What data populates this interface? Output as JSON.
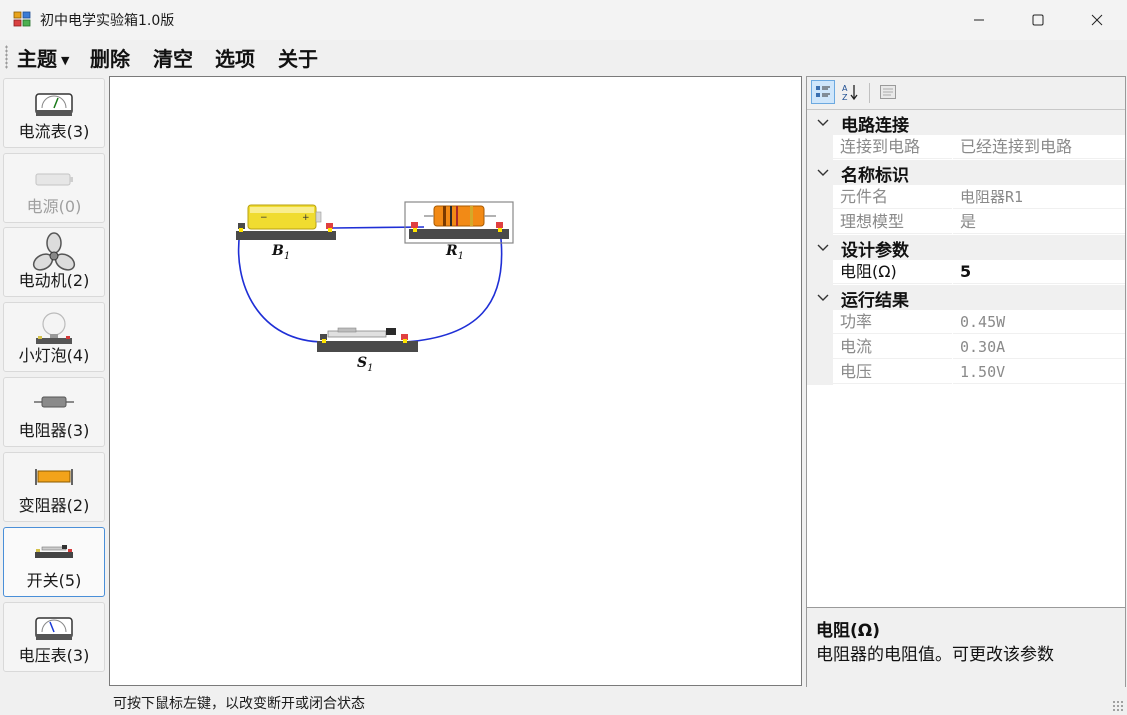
{
  "window": {
    "title": "初中电学实验箱1.0版",
    "buttons": [
      "minimize",
      "maximize",
      "close"
    ]
  },
  "menu": {
    "items": [
      {
        "label": "主题",
        "has_dropdown": true
      },
      {
        "label": "删除"
      },
      {
        "label": "清空"
      },
      {
        "label": "选项"
      },
      {
        "label": "关于"
      }
    ]
  },
  "toolbox": {
    "items": [
      {
        "label": "电流表(3)",
        "icon": "ammeter-icon",
        "enabled": true
      },
      {
        "label": "电源(0)",
        "icon": "battery-icon",
        "enabled": false
      },
      {
        "label": "电动机(2)",
        "icon": "motor-fan-icon",
        "enabled": true
      },
      {
        "label": "小灯泡(4)",
        "icon": "bulb-icon",
        "enabled": true
      },
      {
        "label": "电阻器(3)",
        "icon": "resistor-icon",
        "enabled": true
      },
      {
        "label": "变阻器(2)",
        "icon": "rheostat-icon",
        "enabled": true
      },
      {
        "label": "开关(5)",
        "icon": "switch-icon",
        "enabled": true,
        "selected": true
      },
      {
        "label": "电压表(3)",
        "icon": "voltmeter-icon",
        "enabled": true
      }
    ]
  },
  "canvas": {
    "components": [
      {
        "id": "B",
        "sub": "1",
        "type": "battery"
      },
      {
        "id": "R",
        "sub": "1",
        "type": "resistor",
        "selected": true
      },
      {
        "id": "S",
        "sub": "1",
        "type": "switch"
      }
    ],
    "wire_color": "#1f2fd6"
  },
  "property_grid": {
    "toolbar": [
      "categorized-icon",
      "alphabetical-icon",
      "property-pages-icon"
    ],
    "categories": [
      {
        "label": "电路连接",
        "rows": [
          {
            "name": "连接到电路",
            "value": "已经连接到电路"
          }
        ]
      },
      {
        "label": "名称标识",
        "rows": [
          {
            "name": "元件名",
            "value": "电阻器R1"
          },
          {
            "name": "理想模型",
            "value": "是"
          }
        ]
      },
      {
        "label": "设计参数",
        "rows": [
          {
            "name": "电阻(Ω)",
            "value": "5",
            "editable": true
          }
        ]
      },
      {
        "label": "运行结果",
        "rows": [
          {
            "name": "功率",
            "value": "0.45W"
          },
          {
            "name": "电流",
            "value": "0.30A"
          },
          {
            "name": "电压",
            "value": "1.50V"
          }
        ]
      }
    ],
    "description": {
      "title": "电阻(Ω)",
      "text": "电阻器的电阻值。可更改该参数"
    }
  },
  "status": {
    "text": "可按下鼠标左键，以改变断开或闭合状态"
  }
}
